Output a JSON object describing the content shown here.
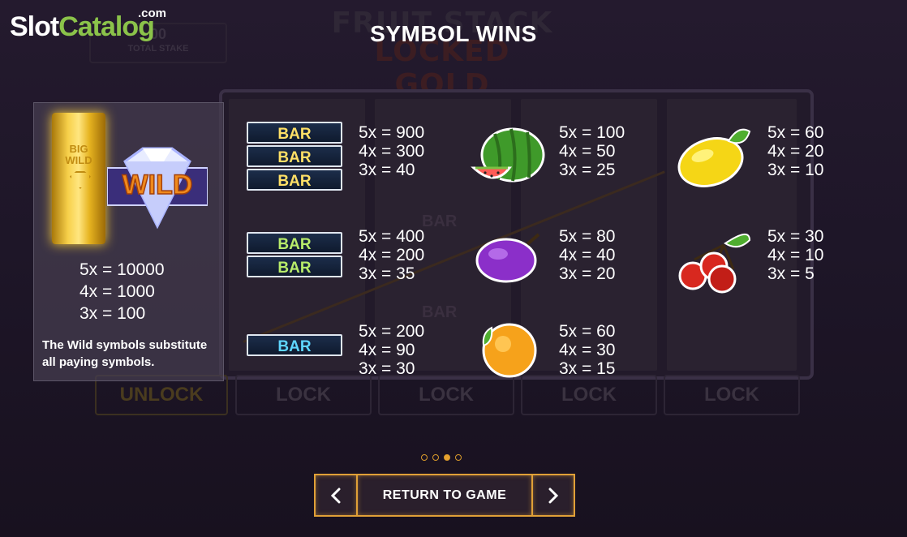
{
  "brand": {
    "slot": "Slot",
    "catalog": "Catalog",
    "com": ".com"
  },
  "background": {
    "logo_line1": "FRUIT STACK",
    "logo_line2": "LOCKED GOLD",
    "stake_value": "00",
    "stake_label": "TOTAL STAKE",
    "unlock_label": "UNLOCK",
    "lock_label": "LOCK"
  },
  "title": "SYMBOL WINS",
  "wild": {
    "bar_text_1": "BIG",
    "bar_text_2": "WILD",
    "gem_text": "WILD",
    "pays": [
      "5x = 10000",
      "4x = 1000",
      "3x = 100"
    ],
    "note": "The Wild symbols substitute all paying symbols."
  },
  "symbols": [
    {
      "id": "bar-triple",
      "bar_label": "BAR",
      "pays": [
        "5x = 900",
        "4x = 300",
        "3x = 40"
      ]
    },
    {
      "id": "watermelon",
      "icon": "watermelon-icon",
      "pays": [
        "5x = 100",
        "4x = 50",
        "3x = 25"
      ]
    },
    {
      "id": "lemon",
      "icon": "lemon-icon",
      "pays": [
        "5x = 60",
        "4x = 20",
        "3x = 10"
      ]
    },
    {
      "id": "bar-double",
      "bar_label": "BAR",
      "pays": [
        "5x = 400",
        "4x = 200",
        "3x = 35"
      ]
    },
    {
      "id": "plum",
      "icon": "plum-icon",
      "pays": [
        "5x = 80",
        "4x = 40",
        "3x = 20"
      ]
    },
    {
      "id": "cherries",
      "icon": "cherries-icon",
      "pays": [
        "5x = 30",
        "4x = 10",
        "3x = 5"
      ]
    },
    {
      "id": "bar-single",
      "bar_label": "BAR",
      "pays": [
        "5x = 200",
        "4x = 90",
        "3x = 30"
      ]
    },
    {
      "id": "orange",
      "icon": "orange-icon",
      "pays": [
        "5x = 60",
        "4x = 30",
        "3x = 15"
      ]
    }
  ],
  "pager": {
    "pages": 4,
    "active_page": 3
  },
  "nav": {
    "return_label": "RETURN TO GAME",
    "prev_icon": "chevron-left-icon",
    "next_icon": "chevron-right-icon"
  },
  "colors": {
    "accent": "#e0a037",
    "brand_green": "#8bc34a",
    "bar_yellow": "#ffe066",
    "bar_green": "#b8ec6a",
    "bar_blue": "#5fd6ff"
  }
}
